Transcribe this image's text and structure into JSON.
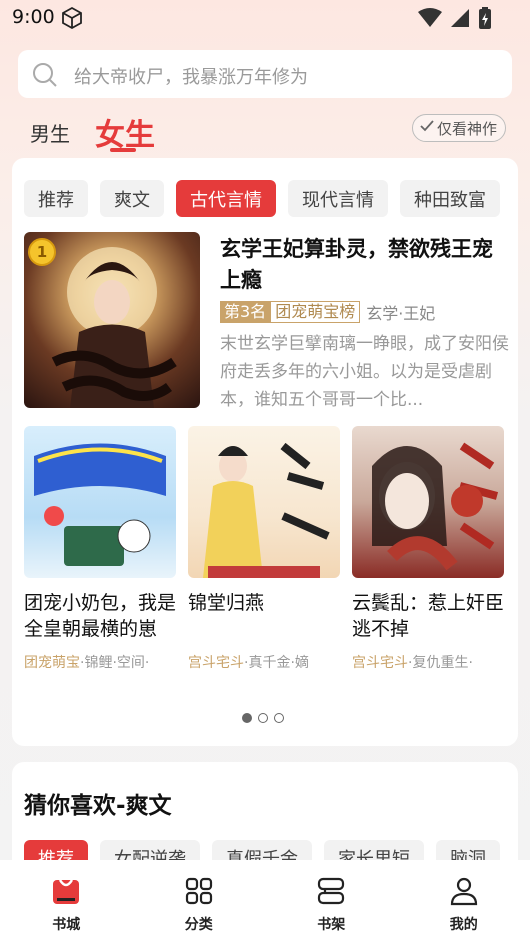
{
  "status": {
    "time": "9:00"
  },
  "search": {
    "placeholder": "给大帝收尸，我暴涨万年修为"
  },
  "gender_tabs": {
    "male": "男生",
    "female": "女生"
  },
  "filter": {
    "label": "仅看神作"
  },
  "categories": [
    "推荐",
    "爽文",
    "古代言情",
    "现代言情",
    "种田致富"
  ],
  "featured": {
    "rank_badge": "1",
    "title": "玄学王妃算卦灵，禁欲残王宠上瘾",
    "rank": "第3名",
    "rank_list": "团宠萌宝榜",
    "genre": "玄学·王妃",
    "desc": "末世玄学巨擘南璃一睁眼，成了安阳侯府走丢多年的六小姐。以为是受虐剧本，谁知五个哥哥一个比..."
  },
  "books": [
    {
      "title": "团宠小奶包，我是全皇朝最横的崽",
      "tag_hl": "团宠萌宝",
      "tags": "·锦鲤·空间·"
    },
    {
      "title": "锦堂归燕",
      "tag_hl": "宫斗宅斗",
      "tags": "·真千金·嫡"
    },
    {
      "title": "云鬓乱：惹上奸臣逃不掉",
      "tag_hl": "宫斗宅斗",
      "tags": "·复仇重生·"
    }
  ],
  "guess": {
    "title": "猜你喜欢-爽文",
    "tags": [
      "推荐",
      "女配逆袭",
      "真假千金",
      "家长里短",
      "脑洞"
    ]
  },
  "nav": {
    "home": "书城",
    "category": "分类",
    "shelf": "书架",
    "me": "我的"
  },
  "colors": {
    "accent": "#e53b3b",
    "gold": "#c9a36a"
  }
}
